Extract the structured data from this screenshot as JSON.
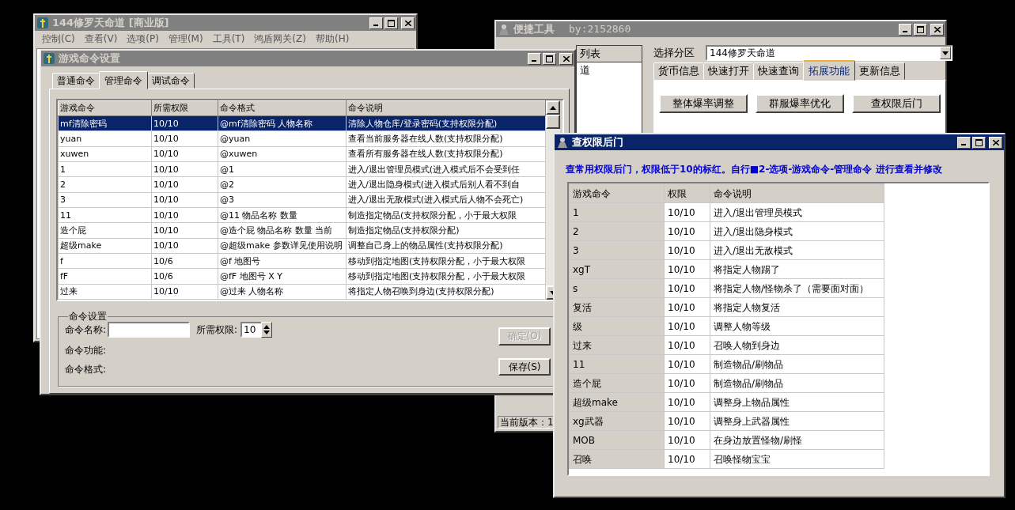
{
  "main_window": {
    "title": "144修罗天命道 [商业版]",
    "menu": [
      "控制(C)",
      "查看(V)",
      "选项(P)",
      "管理(M)",
      "工具(T)",
      "鸿盾网关(Z)",
      "帮助(H)"
    ]
  },
  "quick_tools": {
    "title": "便捷工具",
    "author": "by:2152860",
    "list_header": "列表",
    "list_items": [
      "道"
    ],
    "zone_label": "选择分区",
    "zone_value": "144修罗天命道",
    "tabs": [
      {
        "label": "货币信息",
        "selected": false
      },
      {
        "label": "快速打开",
        "selected": false
      },
      {
        "label": "快速查询",
        "selected": false
      },
      {
        "label": "拓展功能",
        "selected": true
      },
      {
        "label": "更新信息",
        "selected": false
      }
    ],
    "buttons": [
      "整体爆率调整",
      "群服爆率优化",
      "查权限后门"
    ],
    "version": "当前版本：1"
  },
  "command_settings": {
    "title": "游戏命令设置",
    "tabs": [
      {
        "label": "普通命令",
        "selected": false
      },
      {
        "label": "管理命令",
        "selected": true
      },
      {
        "label": "调试命令",
        "selected": false
      }
    ],
    "table": {
      "columns": [
        "游戏命令",
        "所需权限",
        "命令格式",
        "命令说明"
      ],
      "rows": [
        {
          "cells": [
            "mf清除密码",
            "10/10",
            "@mf清除密码 人物名称",
            "清除人物仓库/登录密码(支持权限分配)"
          ],
          "selected": true
        },
        {
          "cells": [
            "yuan",
            "10/10",
            "@yuan",
            "查看当前服务器在线人数(支持权限分配)"
          ],
          "selected": false
        },
        {
          "cells": [
            "xuwen",
            "10/10",
            "@xuwen",
            "查看所有服务器在线人数(支持权限分配)"
          ],
          "selected": false
        },
        {
          "cells": [
            "1",
            "10/10",
            "@1",
            "进入/退出管理员模式(进入模式后不会受到任"
          ],
          "selected": false
        },
        {
          "cells": [
            "2",
            "10/10",
            "@2",
            "进入/退出隐身模式(进入模式后别人看不到自"
          ],
          "selected": false
        },
        {
          "cells": [
            "3",
            "10/10",
            "@3",
            "进入/退出无敌模式(进入模式后人物不会死亡)"
          ],
          "selected": false
        },
        {
          "cells": [
            "11",
            "10/10",
            "@11 物品名称 数量",
            "制造指定物品(支持权限分配，小于最大权限"
          ],
          "selected": false
        },
        {
          "cells": [
            "造个屁",
            "10/10",
            "@造个屁 物品名称 数量 当前",
            "制造指定物品(支持权限分配)"
          ],
          "selected": false
        },
        {
          "cells": [
            "超级make",
            "10/10",
            "@超级make 参数详见使用说明",
            "调整自己身上的物品属性(支持权限分配)"
          ],
          "selected": false
        },
        {
          "cells": [
            "f",
            "10/6",
            "@f 地图号",
            "移动到指定地图(支持权限分配，小于最大权限"
          ],
          "selected": false
        },
        {
          "cells": [
            "fF",
            "10/6",
            "@fF 地图号 X Y",
            "移动到指定地图(支持权限分配，小于最大权限"
          ],
          "selected": false
        },
        {
          "cells": [
            "过来",
            "10/10",
            "@过来 人物名称",
            "将指定人物召唤到身边(支持权限分配)"
          ],
          "selected": false
        }
      ]
    },
    "group": {
      "title": "命令设置",
      "name_label": "命令名称:",
      "level_label": "所需权限:",
      "level_value": "10",
      "function_label": "命令功能:",
      "format_label": "命令格式:",
      "buttons": [
        {
          "label": "确定(O)",
          "disabled": true
        },
        {
          "label": "保存(S)",
          "disabled": false
        }
      ]
    }
  },
  "backdoor_dialog": {
    "title": "查权限后门",
    "notice": "查常用权限后门，权限低于10的标红。自行■2-选项-游戏命令-管理命令 进行查看并修改",
    "table": {
      "columns": [
        "游戏命令",
        "权限",
        "命令说明"
      ],
      "rows": [
        [
          "1",
          "10/10",
          "进入/退出管理员模式"
        ],
        [
          "2",
          "10/10",
          "进入/退出隐身模式"
        ],
        [
          "3",
          "10/10",
          "进入/退出无敌模式"
        ],
        [
          "xgT",
          "10/10",
          "将指定人物踢了"
        ],
        [
          "s",
          "10/10",
          "将指定人物/怪物杀了（需要面对面）"
        ],
        [
          "复活",
          "10/10",
          "将指定人物复活"
        ],
        [
          "级",
          "10/10",
          "调整人物等级"
        ],
        [
          "过来",
          "10/10",
          "召唤人物到身边"
        ],
        [
          "11",
          "10/10",
          "制造物品/刷物品"
        ],
        [
          "造个屁",
          "10/10",
          "制造物品/刷物品"
        ],
        [
          "超级make",
          "10/10",
          "调整身上物品属性"
        ],
        [
          "xg武器",
          "10/10",
          "调整身上武器属性"
        ],
        [
          "MOB",
          "10/10",
          "在身边放置怪物/刷怪"
        ],
        [
          "召唤",
          "10/10",
          "召唤怪物宝宝"
        ]
      ]
    }
  }
}
